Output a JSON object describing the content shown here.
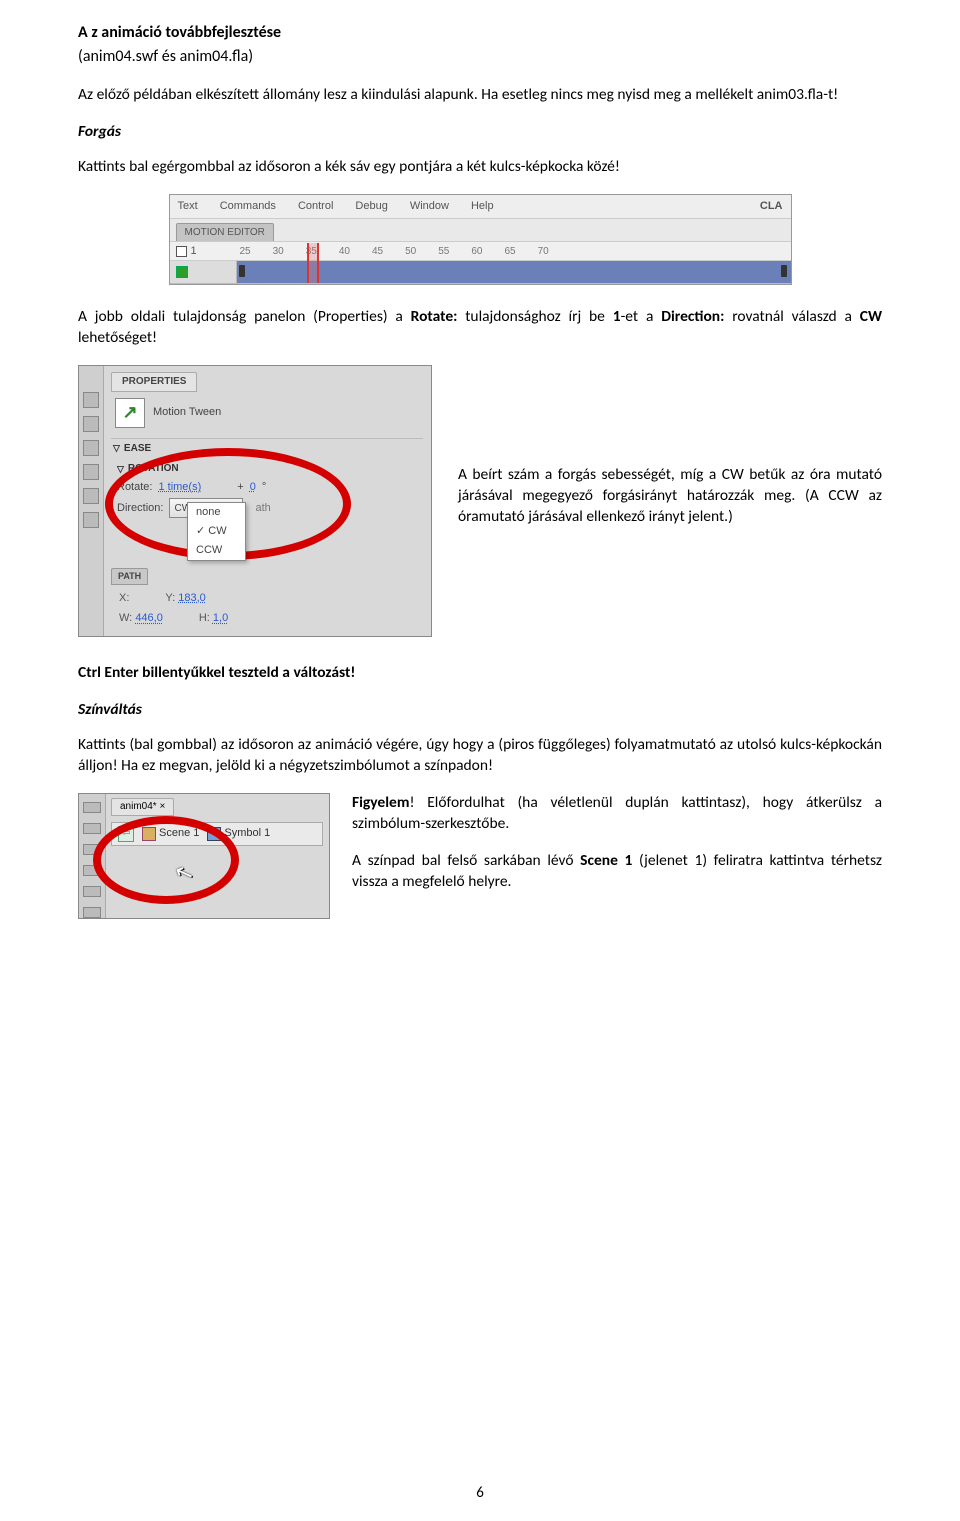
{
  "title": "A z animáció továbbfejlesztése",
  "subtitle": "(anim04.swf és anim04.fla)",
  "intro": "Az előző példában elkészített állomány lesz a kiindulási alapunk. Ha esetleg nincs meg nyisd meg a mellékelt anim03.fla-t!",
  "forgas": {
    "head": "Forgás",
    "p1": "Kattints bal egérgombbal az idősoron a kék sáv egy pontjára a két kulcs-képkocka közé!",
    "timeline": {
      "menus": [
        "Text",
        "Commands",
        "Control",
        "Debug",
        "Window",
        "Help"
      ],
      "cla": "CLA",
      "motion_editor_tab": "MOTION EDITOR",
      "ruler": [
        "1",
        "25",
        "30",
        "35",
        "40",
        "45",
        "50",
        "55",
        "60",
        "65",
        "70"
      ]
    },
    "p2_pre": "A jobb oldali tulajdonság panelon (Properties) a ",
    "p2_rotate": "Rotate:",
    "p2_mid": " tulajdonsághoz írj be ",
    "p2_one": "1",
    "p2_mid2": "-et a ",
    "p2_dir": "Direction:",
    "p2_mid3": " rovatnál válaszd a ",
    "p2_cw": "CW",
    "p2_end": " lehetőséget!",
    "panel": {
      "tab": "PROPERTIES",
      "motion_tween": "Motion Tween",
      "ease": "EASE",
      "rotation": "ROTATION",
      "rotate_label": "Rotate:",
      "rotate_val": "1 time(s)",
      "plus": "+",
      "zero": "0",
      "deg": "°",
      "direction_label": "Direction:",
      "dd_val": "CW",
      "menu_none": "none",
      "menu_cw": "CW",
      "menu_ccw": "CCW",
      "ath": "ath",
      "path": "PATH",
      "x_label": "X:",
      "y_label": "Y:",
      "y_val": "183,0",
      "w_label": "W:",
      "w_val": "446,0",
      "h_label": "H:",
      "h_val": "1,0"
    },
    "side_text": "A beírt szám a forgás sebességét, míg a CW betűk az óra mutató járásával megegyező forgásirányt határozzák meg. (A CCW az óramutató járásával ellenkező irányt jelent.)"
  },
  "ctrl_enter": "Ctrl Enter billentyűkkel teszteld a változást!",
  "szinvaltas": {
    "head": "Színváltás",
    "p1": "Kattints (bal gombbal) az idősoron az animáció végére, úgy hogy a (piros függőleges) folyamatmutató az utolsó kulcs-képkockán álljon! Ha ez megvan, jelöld ki a négyzetszimbólumot a színpadon!",
    "shot": {
      "tab": "anim04*",
      "close": "×",
      "scene": "Scene 1",
      "symbol": "Symbol 1"
    },
    "warn_lead": "Figyelem",
    "warn_rest": "! Előfordulhat (ha véletlenül duplán kattintasz), hogy átkerülsz a szimbólum-szerkesztőbe.",
    "p2_pre": "A színpad bal felső sarkában lévő ",
    "p2_scene": "Scene 1",
    "p2_rest": " (jelenet 1) feliratra kattintva térhetsz vissza a megfelelő helyre."
  },
  "page_num": "6"
}
